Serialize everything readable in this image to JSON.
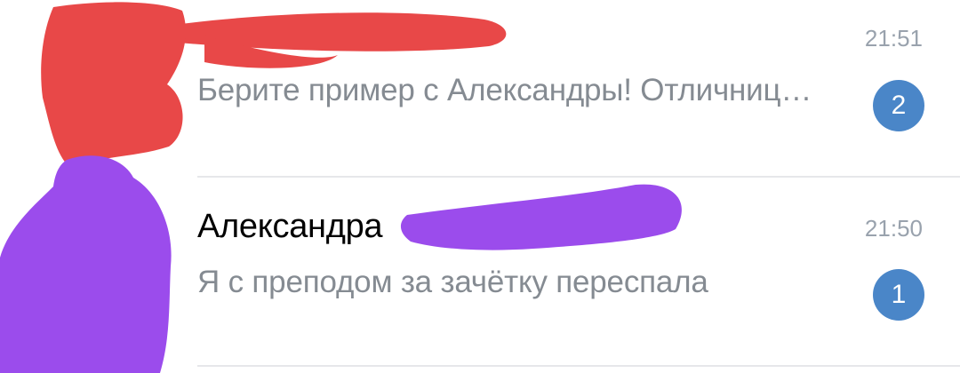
{
  "chats": [
    {
      "name": "",
      "preview": "Берите пример с Александры! Отличниц…",
      "time": "21:51",
      "unread": "2"
    },
    {
      "name": "Александра",
      "preview": "Я с преподом за зачётку переспала",
      "time": "21:50",
      "unread": "1"
    }
  ],
  "colors": {
    "badge": "#4a86c8",
    "preview_text": "#858b92",
    "time_text": "#99a2ad",
    "red_scribble": "#e84848",
    "purple_scribble": "#9b4cec"
  }
}
